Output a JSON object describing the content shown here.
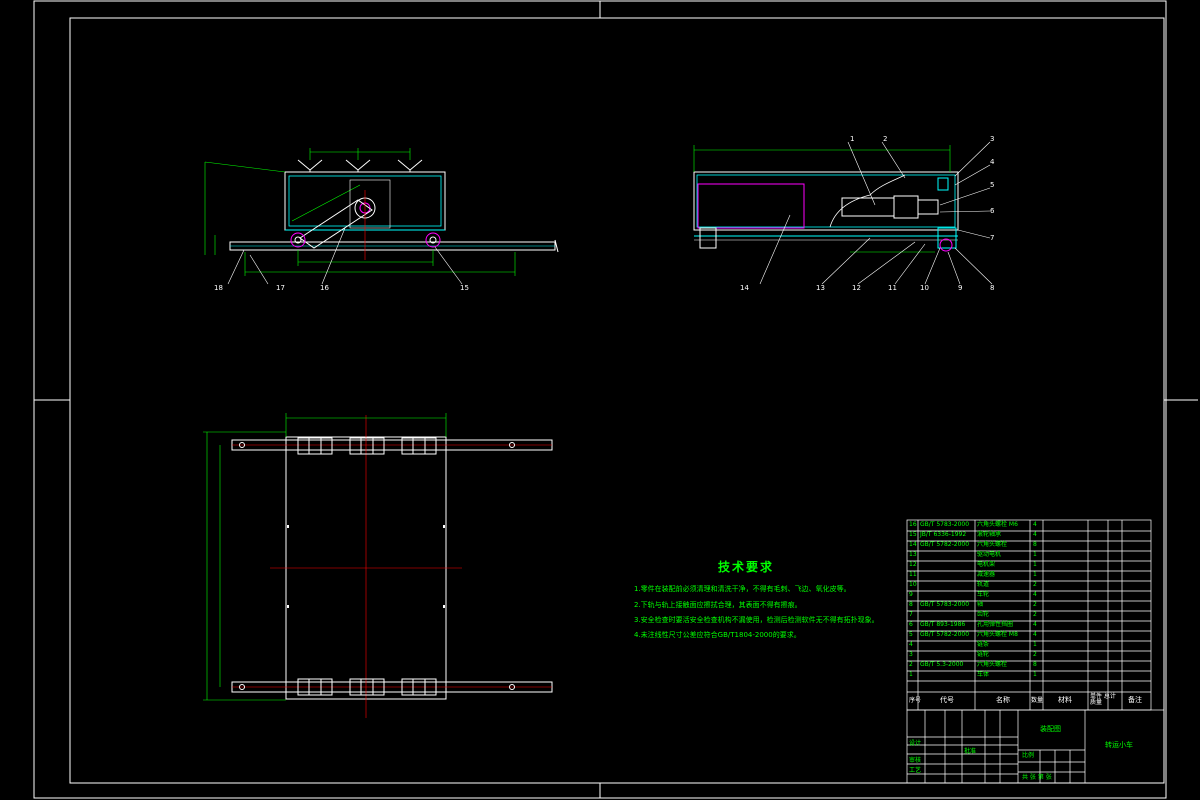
{
  "technical_requirements": {
    "title": "技术要求",
    "lines": [
      "1.零件在装配前必须清理和清洗干净，不得有毛刺、飞边、氧化皮等。",
      "2.下轨与轨上接触面应擦拭合理，其表面不得有擦痕。",
      "3.安全检查时要活安全检查机构不漏使用，检测后检测软件无不得有拓扑现象。",
      "4.未注线性尺寸公差应符合GB/T1804-2000的要求。"
    ]
  },
  "parts_list": {
    "header": {
      "index": "序号",
      "code": "代号",
      "name": "名称",
      "qty": "数量",
      "material": "材料",
      "mass": "单件 总计 质量",
      "remark": "备注"
    },
    "rows": [
      {
        "index": "16",
        "code": "GB/T 5783-2000",
        "name": "六角头螺栓 M6",
        "qty": "4"
      },
      {
        "index": "15",
        "code": "JB/T 6336-1992",
        "name": "滚轮轴承",
        "qty": "4"
      },
      {
        "index": "14",
        "code": "GB/T 5782-2000",
        "name": "六角头螺栓",
        "qty": "8"
      },
      {
        "index": "13",
        "code": "",
        "name": "驱动电机",
        "qty": "1"
      },
      {
        "index": "12",
        "code": "",
        "name": "电机架",
        "qty": "1"
      },
      {
        "index": "11",
        "code": "",
        "name": "减速器",
        "qty": "1"
      },
      {
        "index": "10",
        "code": "",
        "name": "轨道",
        "qty": "2"
      },
      {
        "index": "9",
        "code": "",
        "name": "车轮",
        "qty": "4"
      },
      {
        "index": "8",
        "code": "GB/T 5783-2000",
        "name": "轴",
        "qty": "2"
      },
      {
        "index": "7",
        "code": "",
        "name": "齿轮",
        "qty": "2"
      },
      {
        "index": "6",
        "code": "GB/T 893-1986",
        "name": "孔用弹性挡圈",
        "qty": "4"
      },
      {
        "index": "5",
        "code": "GB/T 5782-2000",
        "name": "六角头螺栓 M8",
        "qty": "4"
      },
      {
        "index": "4",
        "code": "",
        "name": "链条",
        "qty": "1"
      },
      {
        "index": "3",
        "code": "",
        "name": "链轮",
        "qty": "2"
      },
      {
        "index": "2",
        "code": "GB/T 5.3-2000",
        "name": "六角头螺栓",
        "qty": "8"
      },
      {
        "index": "1",
        "code": "",
        "name": "车体",
        "qty": "1"
      }
    ]
  },
  "title_block": {
    "drawing_title": "装配图",
    "drawing_name": "转运小车",
    "label_design": "设计",
    "label_check": "审核",
    "label_approve": "批准",
    "label_craft": "工艺",
    "label_scale": "比例",
    "label_sheet": "共 张 第 张"
  },
  "view_labels": {
    "front": [
      "18",
      "17",
      "16",
      "15"
    ],
    "side_top": [
      "1",
      "2",
      "3",
      "4",
      "5",
      "6",
      "7"
    ],
    "side_bottom": [
      "14",
      "13",
      "12",
      "11",
      "10",
      "9",
      "8"
    ]
  },
  "colors": {
    "background": "#000000",
    "frame": "#ffffff",
    "dimension": "#00ff00",
    "centerline": "#ff0000",
    "part": "#00ffff",
    "hidden": "#ff00ff"
  }
}
